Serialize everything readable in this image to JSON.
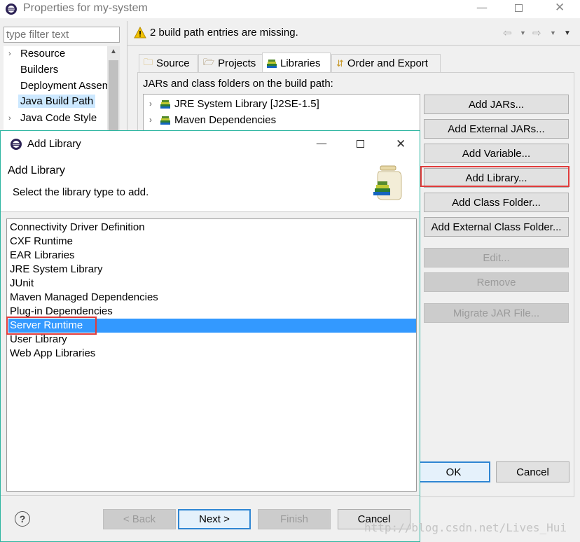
{
  "main_window": {
    "title": "Properties for my-system",
    "filter_placeholder": "type filter text",
    "nav_items": [
      {
        "label": "Resource",
        "has_arrow": true
      },
      {
        "label": "Builders",
        "has_arrow": false
      },
      {
        "label": "Deployment Assembly",
        "has_arrow": false
      },
      {
        "label": "Java Build Path",
        "has_arrow": false,
        "selected": true
      },
      {
        "label": "Java Code Style",
        "has_arrow": true
      }
    ],
    "warning_message": "2 build path entries are missing.",
    "tabs": [
      "Source",
      "Projects",
      "Libraries",
      "Order and Export"
    ],
    "active_tab": "Libraries",
    "libraries_heading": "JARs and class folders on the build path:",
    "build_path_entries": [
      "JRE System Library [J2SE-1.5]",
      "Maven Dependencies"
    ],
    "buttons": {
      "add_jars": "Add JARs...",
      "add_external_jars": "Add External JARs...",
      "add_variable": "Add Variable...",
      "add_library": "Add Library...",
      "add_class_folder": "Add Class Folder...",
      "add_external_class_folder": "Add External Class Folder...",
      "edit": "Edit...",
      "remove": "Remove",
      "migrate_jar": "Migrate JAR File...",
      "ok": "OK",
      "cancel": "Cancel"
    }
  },
  "dialog": {
    "title": "Add Library",
    "heading": "Add Library",
    "subheading": "Select the library type to add.",
    "library_types": [
      "Connectivity Driver Definition",
      "CXF Runtime",
      "EAR Libraries",
      "JRE System Library",
      "JUnit",
      "Maven Managed Dependencies",
      "Plug-in Dependencies",
      "Server Runtime",
      "User Library",
      "Web App Libraries"
    ],
    "selected_type": "Server Runtime",
    "buttons": {
      "help": "?",
      "back": "< Back",
      "next": "Next >",
      "finish": "Finish",
      "cancel": "Cancel"
    }
  },
  "watermark": "http://blog.csdn.net/Lives_Hui",
  "colors": {
    "selection": "#3399ff",
    "highlight_box": "#e03b3b",
    "dialog_border": "#2bb5a0"
  }
}
